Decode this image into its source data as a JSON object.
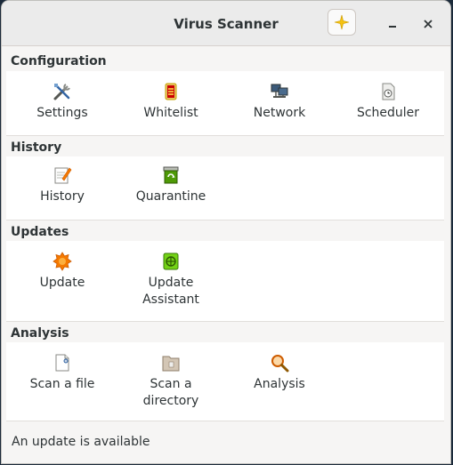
{
  "window": {
    "title": "Virus Scanner"
  },
  "titlebar": {
    "sparkle_icon": "sparkle-icon",
    "minimize_label": "–",
    "close_label": "✕"
  },
  "sections": {
    "configuration": {
      "title": "Configuration",
      "items": [
        {
          "label": "Settings",
          "icon": "tools-icon"
        },
        {
          "label": "Whitelist",
          "icon": "shield-icon"
        },
        {
          "label": "Network",
          "icon": "network-icon"
        },
        {
          "label": "Scheduler",
          "icon": "scheduler-icon"
        }
      ]
    },
    "history": {
      "title": "History",
      "items": [
        {
          "label": "History",
          "icon": "history-icon"
        },
        {
          "label": "Quarantine",
          "icon": "quarantine-icon"
        }
      ]
    },
    "updates": {
      "title": "Updates",
      "items": [
        {
          "label": "Update",
          "icon": "update-icon"
        },
        {
          "label_line1": "Update",
          "label_line2": "Assistant",
          "icon": "update-assistant-icon"
        }
      ]
    },
    "analysis": {
      "title": "Analysis",
      "items": [
        {
          "label": "Scan a file",
          "icon": "scan-file-icon"
        },
        {
          "label_line1": "Scan a",
          "label_line2": "directory",
          "icon": "scan-directory-icon"
        },
        {
          "label": "Analysis",
          "icon": "magnifier-icon"
        }
      ]
    }
  },
  "status": {
    "text": "An update is available"
  }
}
